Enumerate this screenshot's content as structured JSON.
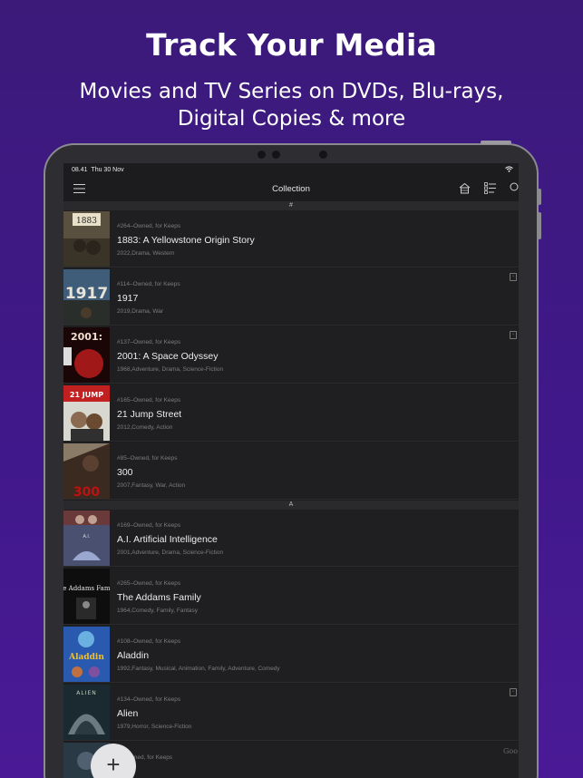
{
  "promo": {
    "headline": "Track Your Media",
    "subline_1": "Movies and TV Series on DVDs, Blu-rays,",
    "subline_2": "Digital Copies & more"
  },
  "status_bar": {
    "time": "08.41",
    "date": "Thu 30 Nov"
  },
  "nav": {
    "title": "Collection"
  },
  "sections": [
    {
      "header": "#",
      "items": [
        {
          "meta": "#264–Owned, for Keeps",
          "title": "1883: A Yellowstone Origin Story",
          "info": "2022,Drama, Western",
          "poster_label": "1883",
          "poster_color": "#5a5040",
          "badge": false
        },
        {
          "meta": "#114–Owned, for Keeps",
          "title": "1917",
          "info": "2019,Drama, War",
          "poster_label": "1917",
          "poster_color": "#3f5c78",
          "badge": true
        },
        {
          "meta": "#137–Owned, for Keeps",
          "title": "2001: A Space Odyssey",
          "info": "1968,Adventure, Drama, Science-Fiction",
          "poster_label": "2001:",
          "poster_color": "#7a1515",
          "badge": true
        },
        {
          "meta": "#165–Owned, for Keeps",
          "title": "21 Jump Street",
          "info": "2012,Comedy, Action",
          "poster_label": "21 JUMP",
          "poster_color": "#d8d8d0",
          "badge": false
        },
        {
          "meta": "#85–Owned, for Keeps",
          "title": "300",
          "info": "2007,Fantasy, War, Action",
          "poster_label": "300",
          "poster_color": "#5a4a3a",
          "badge": false
        }
      ]
    },
    {
      "header": "A",
      "items": [
        {
          "meta": "#169–Owned, for Keeps",
          "title": "A.I. Artificial Intelligence",
          "info": "2001,Adventure, Drama, Science-Fiction",
          "poster_label": "A.I.",
          "poster_color": "#4a5070",
          "badge": false
        },
        {
          "meta": "#265–Owned, for Keeps",
          "title": "The Addams Family",
          "info": "1964,Comedy, Family, Fantasy",
          "poster_label": "The Addams Family",
          "poster_color": "#111111",
          "badge": false
        },
        {
          "meta": "#108–Owned, for Keeps",
          "title": "Aladdin",
          "info": "1992,Fantasy, Musical, Animation, Family, Adventure, Comedy",
          "poster_label": "Aladdin",
          "poster_color": "#2a5ab0",
          "badge": false
        },
        {
          "meta": "#134–Owned, for Keeps",
          "title": "Alien",
          "info": "1979,Horror, Science-Fiction",
          "poster_label": "ALIEN",
          "poster_color": "#1a2a30",
          "badge": true
        },
        {
          "meta": "...–Owned, for Keeps",
          "title": "",
          "info": "",
          "poster_label": "",
          "poster_color": "#2a3a45",
          "badge": false
        }
      ]
    }
  ],
  "fab": {
    "label": "+"
  },
  "watermark": "Goo"
}
